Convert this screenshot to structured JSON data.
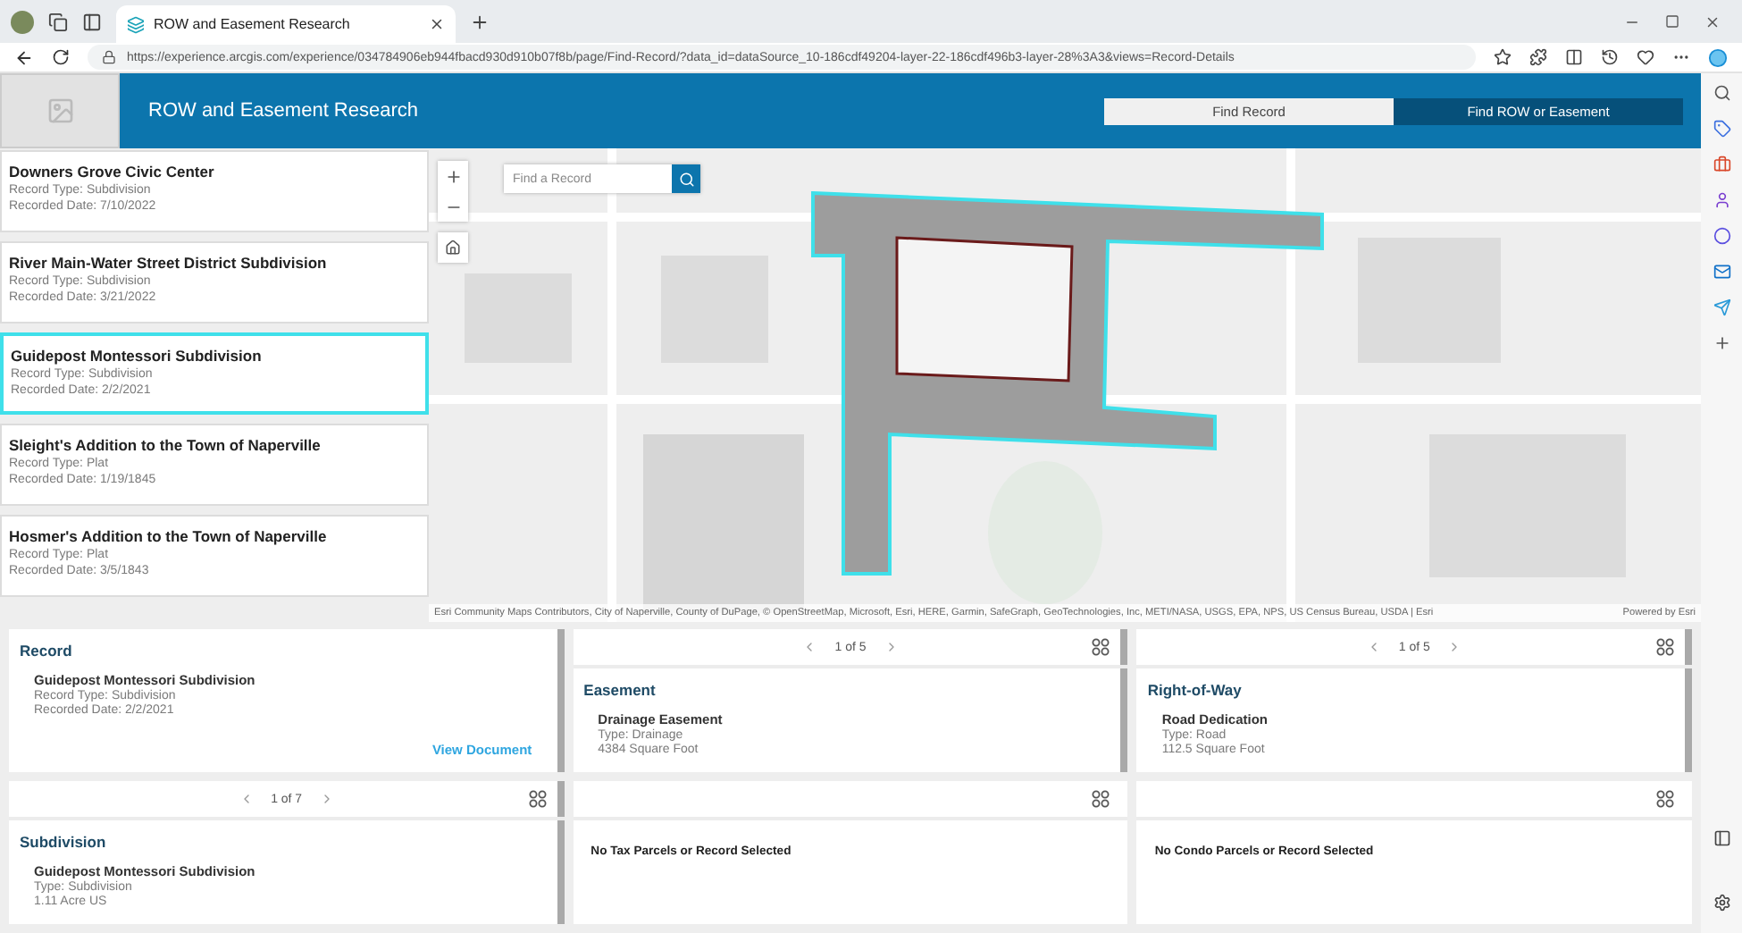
{
  "browser": {
    "tab_title": "ROW and Easement Research",
    "url": "https://experience.arcgis.com/experience/034784906eb944fbacd930d910b07f8b/page/Find-Record/?data_id=dataSource_10-186cdf49204-layer-22-186cdf496b3-layer-28%3A3&views=Record-Details"
  },
  "header": {
    "title": "ROW and Easement Research",
    "nav": [
      {
        "label": "Find Record",
        "selected": true
      },
      {
        "label": "Find ROW or Easement",
        "selected": false
      }
    ]
  },
  "records": [
    {
      "title": "Downers Grove Civic Center",
      "type": "Record Type: Subdivision",
      "date": "Recorded Date: 7/10/2022",
      "selected": false
    },
    {
      "title": "River Main-Water Street District Subdivision",
      "type": "Record Type: Subdivision",
      "date": "Recorded Date: 3/21/2022",
      "selected": false
    },
    {
      "title": "Guidepost Montessori Subdivision",
      "type": "Record Type: Subdivision",
      "date": "Recorded Date: 2/2/2021",
      "selected": true
    },
    {
      "title": "Sleight's Addition to the Town of Naperville",
      "type": "Record Type: Plat",
      "date": "Recorded Date: 1/19/1845",
      "selected": false
    },
    {
      "title": "Hosmer's Addition to the Town of Naperville",
      "type": "Record Type: Plat",
      "date": "Recorded Date: 3/5/1843",
      "selected": false
    }
  ],
  "map": {
    "search_placeholder": "Find a Record",
    "attribution": "Esri Community Maps Contributors, City of Naperville, County of DuPage, © OpenStreetMap, Microsoft, Esri, HERE, Garmin, SafeGraph, GeoTechnologies, Inc, METI/NASA, USGS, EPA, NPS, US Census Bureau, USDA | Esri",
    "powered_by": "Powered by Esri"
  },
  "panels": [
    {
      "kind": "record",
      "title": "Record",
      "name": "Guidepost Montessori Subdivision",
      "lines": [
        "Record Type: Subdivision",
        "Recorded Date: 2/2/2021"
      ],
      "link": "View Document"
    },
    {
      "kind": "detail",
      "pager": "1 of 5",
      "title": "Easement",
      "name": "Drainage Easement",
      "lines": [
        "Type: Drainage",
        "4384 Square Foot"
      ]
    },
    {
      "kind": "detail",
      "pager": "1 of 5",
      "title": "Right-of-Way",
      "name": "Road Dedication",
      "lines": [
        "Type: Road",
        "112.5 Square Foot"
      ]
    },
    {
      "kind": "detail",
      "pager": "1 of 7",
      "title": "Subdivision",
      "name": "Guidepost Montessori Subdivision",
      "lines": [
        "Type: Subdivision",
        "1.11 Acre US"
      ]
    },
    {
      "kind": "empty",
      "message": "No Tax Parcels or Record Selected"
    },
    {
      "kind": "empty",
      "message": "No Condo Parcels or Record Selected"
    }
  ]
}
